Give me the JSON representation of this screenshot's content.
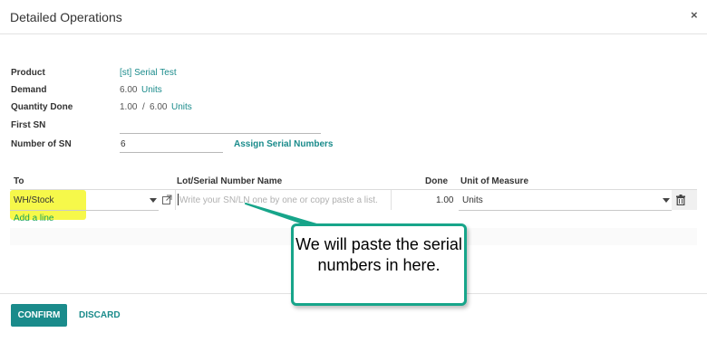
{
  "header": {
    "title": "Detailed Operations",
    "close": "×"
  },
  "fields": {
    "product_label": "Product",
    "product_value": "[st] Serial Test",
    "demand_label": "Demand",
    "demand_value": "6.00",
    "demand_unit": "Units",
    "qty_done_label": "Quantity Done",
    "qty_done_value": "1.00",
    "qty_done_sep": "/",
    "qty_done_total": "6.00",
    "qty_done_unit": "Units",
    "first_sn_label": "First SN",
    "first_sn_value": "",
    "num_sn_label": "Number of SN",
    "num_sn_value": "6",
    "assign_link": "Assign Serial Numbers"
  },
  "table": {
    "headers": {
      "to": "To",
      "lot": "Lot/Serial Number Name",
      "done": "Done",
      "uom": "Unit of Measure"
    },
    "row": {
      "to": "WH/Stock",
      "lot_placeholder": "Write your SN/LN one by one or copy paste a list.",
      "done": "1.00",
      "uom": "Units"
    },
    "add_line": "Add a line"
  },
  "footer": {
    "confirm": "CONFIRM",
    "discard": "DISCARD"
  },
  "callout": {
    "text": "We will paste the serial numbers in here."
  },
  "colors": {
    "accent": "#1a8b8b",
    "highlight": "#f6f84a",
    "callout_border": "#17a58a"
  },
  "icons": [
    "close-icon",
    "dropdown-caret-icon",
    "external-link-icon",
    "trash-icon"
  ]
}
